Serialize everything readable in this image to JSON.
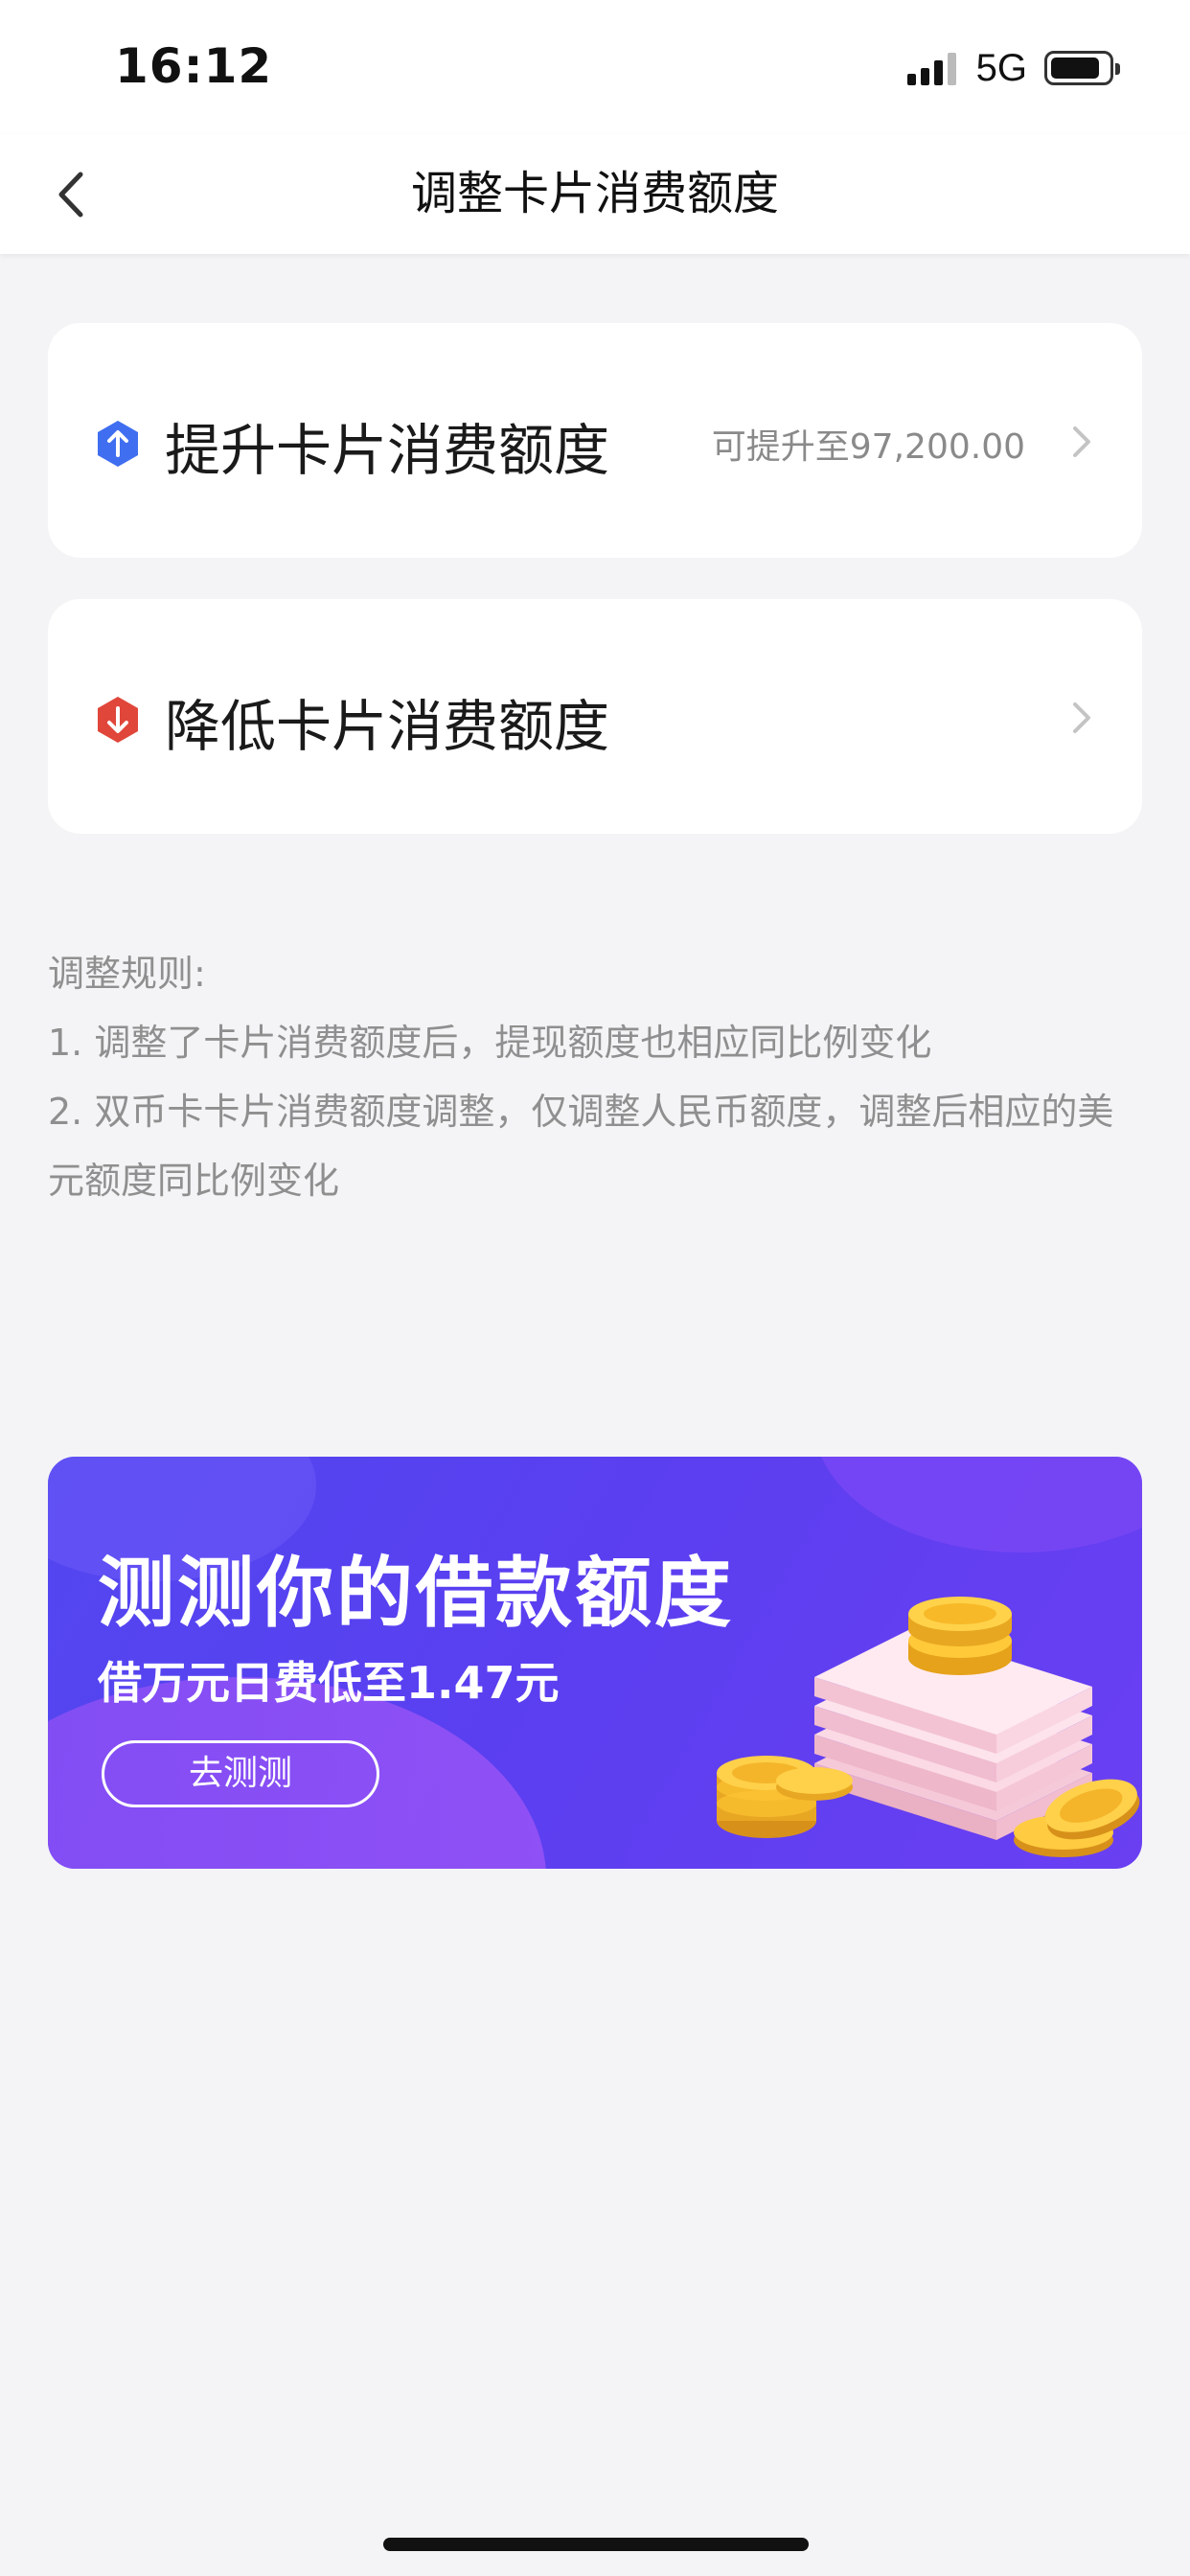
{
  "status_bar": {
    "time": "16:12",
    "network": "5G",
    "icons": [
      "signal-icon",
      "battery-icon"
    ]
  },
  "nav": {
    "title": "调整卡片消费额度",
    "back_icon": "chevron-left-icon"
  },
  "options": [
    {
      "label": "提升卡片消费额度",
      "hint": "可提升至97,200.00",
      "icon": "arrow-up-icon",
      "color": "#3f6ef0"
    },
    {
      "label": "降低卡片消费额度",
      "hint": "",
      "icon": "arrow-down-icon",
      "color": "#e0463a"
    }
  ],
  "rules": {
    "title": "调整规则:",
    "items": [
      "1. 调整了卡片消费额度后，提现额度也相应同比例变化",
      "2. 双币卡卡片消费额度调整，仅调整人民币额度，调整后相应的美元额度同比例变化"
    ]
  },
  "banner": {
    "title": "测测你的借款额度",
    "subtitle": "借万元日费低至1.47元",
    "button_label": "去测测",
    "art_icon": "coins-cash-illustration"
  },
  "colors": {
    "background": "#f4f4f6",
    "card": "#ffffff",
    "banner": "#5a3ff0",
    "hint_text": "#8a8a8a"
  }
}
